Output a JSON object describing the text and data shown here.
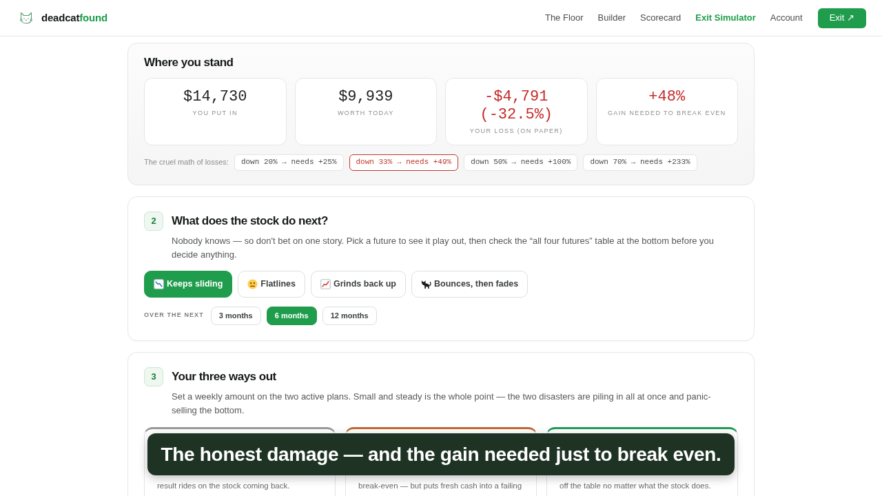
{
  "header": {
    "brand": {
      "name": "deadcat",
      "accent": "found"
    },
    "nav": [
      {
        "label": "The Floor",
        "selected": false
      },
      {
        "label": "Builder",
        "selected": false
      },
      {
        "label": "Scorecard",
        "selected": false
      },
      {
        "label": "Exit Simulator",
        "selected": true
      },
      {
        "label": "Account",
        "selected": false
      }
    ],
    "action_button": {
      "label": "Exit ↗"
    }
  },
  "standing": {
    "title": "Where you stand",
    "stats": [
      {
        "value": "$14,730",
        "label": "YOU PUT IN",
        "negative": false
      },
      {
        "value": "$9,939",
        "label": "WORTH TODAY",
        "negative": false
      },
      {
        "value": "-$4,791 (-32.5%)",
        "label": "YOUR LOSS (ON PAPER)",
        "negative": true
      },
      {
        "value": "+48%",
        "label": "GAIN NEEDED TO BREAK EVEN",
        "negative": true
      }
    ],
    "math": {
      "label": "The cruel math of losses:",
      "chips": [
        {
          "text": "down 20% → needs +25%",
          "selected": false
        },
        {
          "text": "down 33% → needs +49%",
          "selected": true
        },
        {
          "text": "down 50% → needs +100%",
          "selected": false
        },
        {
          "text": "down 70% → needs +233%",
          "selected": false
        }
      ]
    }
  },
  "future": {
    "step": "2",
    "title": "What does the stock do next?",
    "description": "Nobody knows — so don't bet on one story. Pick a future to see it play out, then check the “all four futures” table at the bottom before you decide anything.",
    "scenarios": [
      {
        "label": "Keeps sliding",
        "kind": "down",
        "selected": true
      },
      {
        "label": "Flatlines",
        "kind": "flat",
        "selected": false
      },
      {
        "label": "Grinds back up",
        "kind": "up",
        "selected": false
      },
      {
        "label": "Bounces, then fades",
        "kind": "bounce",
        "selected": false
      }
    ],
    "horizon": {
      "label": "OVER THE NEXT",
      "options": [
        {
          "label": "3 months",
          "selected": false
        },
        {
          "label": "6 months",
          "selected": true
        },
        {
          "label": "12 months",
          "selected": false
        }
      ]
    }
  },
  "ways_out": {
    "step": "3",
    "title": "Your three ways out",
    "description": "Set a weekly amount on the two active plans. Small and steady is the whole point — the two disasters are piling in all at once and panic-selling the bottom.",
    "plans": [
      {
        "color": "#9a9a9a",
        "text": "result rides on the stock coming back."
      },
      {
        "color": "#c4692e",
        "text": "break-even — but puts fresh cash into a failing"
      },
      {
        "color": "#1f9d55",
        "text": "off the table no matter what the stock does."
      }
    ]
  },
  "caption": {
    "text": "The honest damage — and the gain needed just to break even."
  }
}
